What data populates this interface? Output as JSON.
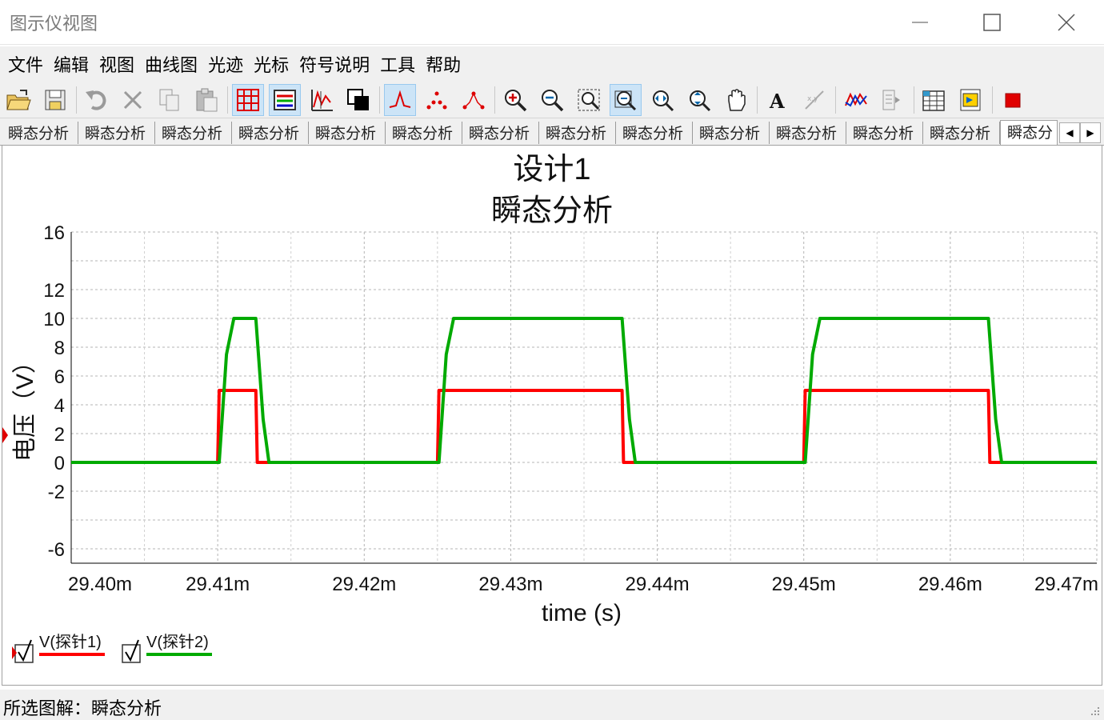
{
  "window": {
    "title": "图示仪视图"
  },
  "menu": [
    "文件",
    "编辑",
    "视图",
    "曲线图",
    "光迹",
    "光标",
    "符号说明",
    "工具",
    "帮助"
  ],
  "toolbar": {
    "buttons": [
      {
        "name": "open-icon",
        "active": false
      },
      {
        "name": "save-icon",
        "active": false
      },
      {
        "name": "undo-icon",
        "active": false
      },
      {
        "name": "delete-icon",
        "active": false
      },
      {
        "name": "copy-icon",
        "active": false
      },
      {
        "name": "paste-icon",
        "active": false
      },
      {
        "name": "grid-icon",
        "active": true
      },
      {
        "name": "legend-icon",
        "active": true
      },
      {
        "name": "select-trace-icon",
        "active": false
      },
      {
        "name": "reverse-colors-icon",
        "active": false
      },
      {
        "name": "show-lines-icon",
        "active": true
      },
      {
        "name": "show-points-icon",
        "active": false
      },
      {
        "name": "show-lines-points-icon",
        "active": false
      },
      {
        "name": "zoom-in-icon",
        "active": false
      },
      {
        "name": "zoom-out-icon",
        "active": false
      },
      {
        "name": "zoom-area-icon",
        "active": false
      },
      {
        "name": "zoom-x-icon",
        "active": true
      },
      {
        "name": "zoom-y-icon",
        "active": false
      },
      {
        "name": "zoom-fit-icon",
        "active": false
      },
      {
        "name": "pan-icon",
        "active": false
      },
      {
        "name": "text-icon",
        "active": false
      },
      {
        "name": "label-icon",
        "active": false
      },
      {
        "name": "overlay-traces-icon",
        "active": false
      },
      {
        "name": "export-icon",
        "active": false
      },
      {
        "name": "export-spreadsheet-icon",
        "active": false
      },
      {
        "name": "export-labview-icon",
        "active": false
      },
      {
        "name": "stop-icon",
        "active": false
      }
    ]
  },
  "tabs": [
    {
      "label": "瞬态分析",
      "active": false
    },
    {
      "label": "瞬态分析",
      "active": false
    },
    {
      "label": "瞬态分析",
      "active": false
    },
    {
      "label": "瞬态分析",
      "active": false
    },
    {
      "label": "瞬态分析",
      "active": false
    },
    {
      "label": "瞬态分析",
      "active": false
    },
    {
      "label": "瞬态分析",
      "active": false
    },
    {
      "label": "瞬态分析",
      "active": false
    },
    {
      "label": "瞬态分析",
      "active": false
    },
    {
      "label": "瞬态分析",
      "active": false
    },
    {
      "label": "瞬态分析",
      "active": false
    },
    {
      "label": "瞬态分析",
      "active": false
    },
    {
      "label": "瞬态分析",
      "active": false
    },
    {
      "label": "瞬态分",
      "active": true
    }
  ],
  "tab_scroll": {
    "left": "◀",
    "right": "▶"
  },
  "chart_data": {
    "type": "line",
    "title": "设计1",
    "subtitle": "瞬态分析",
    "xlabel": "time (s)",
    "ylabel": "电压（V）",
    "xlim": [
      29.4,
      29.47
    ],
    "ylim": [
      -7,
      16
    ],
    "x_unit_note": "milliseconds",
    "xticks": [
      {
        "v": 29.4,
        "label": "29.40m"
      },
      {
        "v": 29.41,
        "label": "29.41m"
      },
      {
        "v": 29.42,
        "label": "29.42m"
      },
      {
        "v": 29.43,
        "label": "29.43m"
      },
      {
        "v": 29.44,
        "label": "29.44m"
      },
      {
        "v": 29.45,
        "label": "29.45m"
      },
      {
        "v": 29.46,
        "label": "29.46m"
      },
      {
        "v": 29.47,
        "label": "29.47m"
      }
    ],
    "yticks": [
      {
        "v": 16,
        "label": "16"
      },
      {
        "v": 12,
        "label": "12"
      },
      {
        "v": 10,
        "label": "10"
      },
      {
        "v": 8,
        "label": "8"
      },
      {
        "v": 6,
        "label": "6"
      },
      {
        "v": 4,
        "label": "4"
      },
      {
        "v": 2,
        "label": "2"
      },
      {
        "v": 0,
        "label": "0"
      },
      {
        "v": -2,
        "label": "-2"
      },
      {
        "v": -6,
        "label": "-6"
      }
    ],
    "grid": true,
    "series": [
      {
        "name": "V(探针1)",
        "color": "#ff0000",
        "x": [
          29.4,
          29.41,
          29.4101,
          29.4126,
          29.4127,
          29.4135,
          29.425,
          29.4251,
          29.4376,
          29.4377,
          29.4385,
          29.45,
          29.4501,
          29.4626,
          29.4627,
          29.4635,
          29.47
        ],
        "y": [
          0,
          0,
          5,
          5,
          0,
          0,
          0,
          5,
          5,
          0,
          0,
          0,
          5,
          5,
          0,
          0,
          0
        ]
      },
      {
        "name": "V(探针2)",
        "color": "#00aa00",
        "x": [
          29.4,
          29.4101,
          29.4106,
          29.4111,
          29.4126,
          29.4131,
          29.4135,
          29.4251,
          29.4256,
          29.4261,
          29.4376,
          29.4381,
          29.4385,
          29.4501,
          29.4506,
          29.4511,
          29.4626,
          29.4631,
          29.4635,
          29.47
        ],
        "y": [
          0,
          0,
          7.5,
          10,
          10,
          3,
          0,
          0,
          7.5,
          10,
          10,
          3,
          0,
          0,
          7.5,
          10,
          10,
          3,
          0,
          0
        ]
      }
    ],
    "legend_position": "bottom-left"
  },
  "legend": [
    {
      "label": "V(探针1)",
      "checked": true,
      "color": "#ff0000"
    },
    {
      "label": "V(探针2)",
      "checked": true,
      "color": "#00aa00"
    }
  ],
  "statusbar": {
    "label": "所选图解：瞬态分析"
  }
}
